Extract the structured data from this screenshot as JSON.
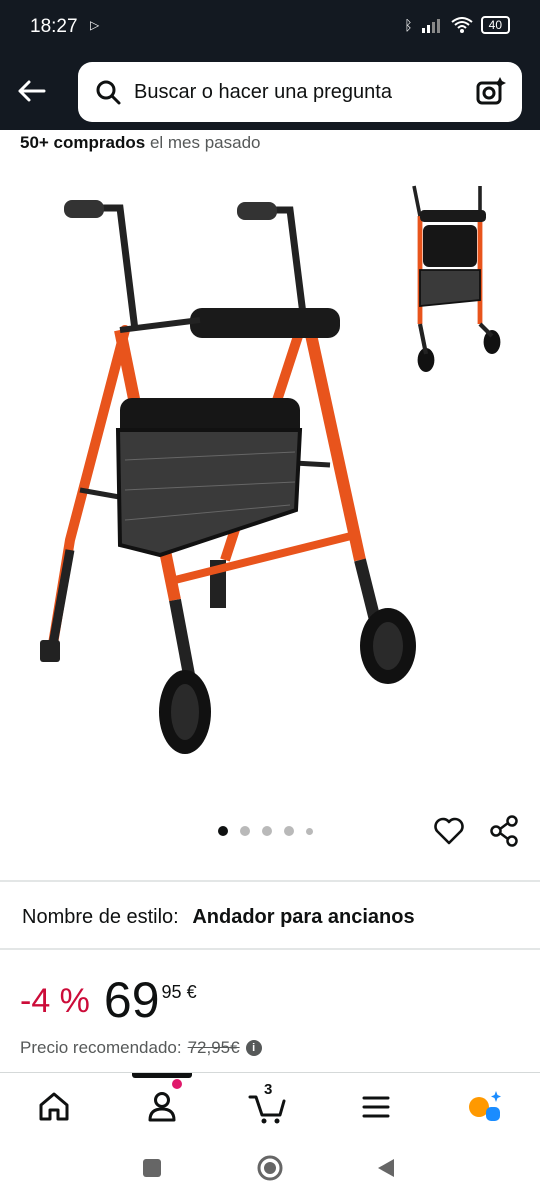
{
  "status_bar": {
    "time": "18:27",
    "battery": "40"
  },
  "header": {
    "search_placeholder": "Buscar o hacer una pregunta"
  },
  "social_proof": {
    "bold": "50+ comprados",
    "rest": "el mes pasado"
  },
  "image_carousel": {
    "count": 5,
    "active_index": 0
  },
  "style": {
    "label": "Nombre de estilo:",
    "value": "Andador para ancianos"
  },
  "price": {
    "discount": "-4 %",
    "whole": "69",
    "fraction": "95 €",
    "recommended_label": "Precio recomendado:",
    "recommended_value": "72,95€",
    "info_icon": "i"
  },
  "bottom_nav": {
    "items": [
      {
        "icon": "home-icon"
      },
      {
        "icon": "account-icon"
      },
      {
        "icon": "cart-icon",
        "count": "3"
      },
      {
        "icon": "menu-icon"
      },
      {
        "icon": "rufus-icon"
      }
    ]
  },
  "colors": {
    "header_bg": "#131921",
    "discount": "#cc0c39",
    "frame": "#e8541c"
  }
}
